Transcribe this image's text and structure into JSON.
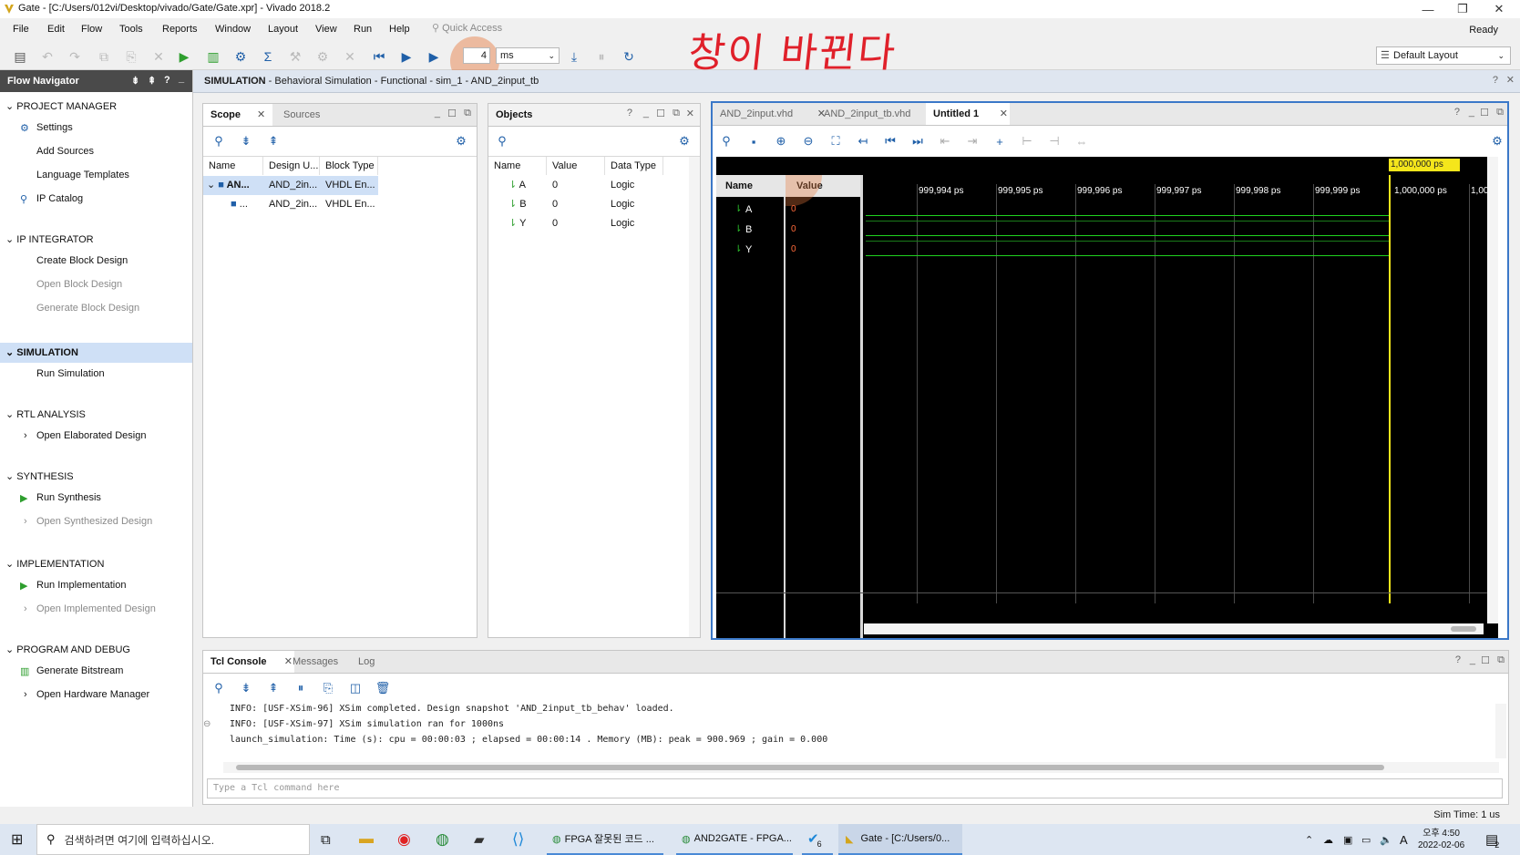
{
  "window": {
    "title": "Gate - [C:/Users/012vi/Desktop/vivado/Gate/Gate.xpr] - Vivado 2018.2",
    "controls": [
      "—",
      "❐",
      "✕"
    ],
    "status": "Ready"
  },
  "menu": {
    "items": [
      "File",
      "Edit",
      "Flow",
      "Tools",
      "Reports",
      "Window",
      "Layout",
      "View",
      "Run",
      "Help"
    ],
    "quick_access_placeholder": "Quick Access"
  },
  "toolbar": {
    "run_time_value": "4",
    "run_time_unit": "ms",
    "layout_select": "Default Layout"
  },
  "annotation": "창이 바뀐다",
  "flow_navigator": {
    "title": "Flow Navigator",
    "sections": [
      {
        "title": "PROJECT MANAGER",
        "items": [
          "Settings",
          "Add Sources",
          "Language Templates",
          "IP Catalog"
        ]
      },
      {
        "title": "IP INTEGRATOR",
        "items": [
          "Create Block Design",
          "Open Block Design",
          "Generate Block Design"
        ]
      },
      {
        "title": "SIMULATION",
        "items": [
          "Run Simulation"
        ]
      },
      {
        "title": "RTL ANALYSIS",
        "items": [
          "Open Elaborated Design"
        ]
      },
      {
        "title": "SYNTHESIS",
        "items": [
          "Run Synthesis",
          "Open Synthesized Design"
        ]
      },
      {
        "title": "IMPLEMENTATION",
        "items": [
          "Run Implementation",
          "Open Implemented Design"
        ]
      },
      {
        "title": "PROGRAM AND DEBUG",
        "items": [
          "Generate Bitstream",
          "Open Hardware Manager"
        ]
      }
    ]
  },
  "sim_header": {
    "bold": "SIMULATION",
    "text": " - Behavioral Simulation - Functional - sim_1 - AND_2input_tb"
  },
  "scope_panel": {
    "tabs": [
      "Scope",
      "Sources"
    ],
    "columns": [
      "Name",
      "Design U...",
      "Block Type"
    ],
    "rows": [
      {
        "name": "AN...",
        "design": "AND_2in...",
        "type": "VHDL En..."
      },
      {
        "name": "...",
        "design": "AND_2in...",
        "type": "VHDL En..."
      }
    ]
  },
  "objects_panel": {
    "title": "Objects",
    "columns": [
      "Name",
      "Value",
      "Data Type"
    ],
    "rows": [
      {
        "name": "A",
        "value": "0",
        "type": "Logic"
      },
      {
        "name": "B",
        "value": "0",
        "type": "Logic"
      },
      {
        "name": "Y",
        "value": "0",
        "type": "Logic"
      }
    ]
  },
  "wave_panel": {
    "tabs": [
      "AND_2input.vhd",
      "AND_2input_tb.vhd",
      "Untitled 1"
    ],
    "name_header": "Name",
    "value_header": "Value",
    "cursor_label": "1,000,000 ps",
    "time_ticks": [
      "999,994 ps",
      "999,995 ps",
      "999,996 ps",
      "999,997 ps",
      "999,998 ps",
      "999,999 ps",
      "1,000,000 ps",
      "1,000,"
    ],
    "signals": [
      {
        "name": "A",
        "value": "0"
      },
      {
        "name": "B",
        "value": "0"
      },
      {
        "name": "Y",
        "value": "0"
      }
    ]
  },
  "console": {
    "tabs": [
      "Tcl Console",
      "Messages",
      "Log"
    ],
    "lines": [
      "INFO: [USF-XSim-96] XSim completed. Design snapshot 'AND_2input_tb_behav' loaded.",
      "INFO: [USF-XSim-97] XSim simulation ran for 1000ns",
      "launch_simulation: Time (s): cpu = 00:00:03 ; elapsed = 00:00:14 . Memory (MB): peak = 900.969 ; gain = 0.000"
    ],
    "input_placeholder": "Type a Tcl command here"
  },
  "statusbar": {
    "sim_time": "Sim Time: 1 us"
  },
  "taskbar": {
    "search_placeholder": "검색하려면 여기에 입력하십시오.",
    "apps": [
      "FPGA 잘못된 코드 ...",
      "AND2GATE - FPGA...",
      "Gate - [C:/Users/0..."
    ],
    "badge": "6",
    "time": "오후 4:50",
    "date": "2022-02-06",
    "ime": "A",
    "notif_count": "2"
  },
  "colors": {
    "accent_blue": "#1f5fa8",
    "wave_green": "#1fd21f",
    "cursor_yellow": "#f5e61b",
    "annotation_red": "#e0202a"
  }
}
